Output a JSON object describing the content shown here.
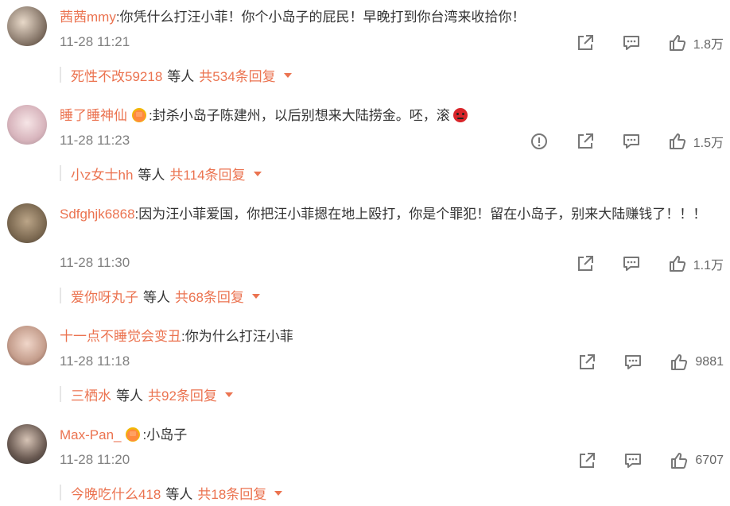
{
  "comments": [
    {
      "username": "茜茜mmy",
      "text": ":你凭什么打汪小菲！你个小岛子的屁民！早晚打到你台湾来收拾你！",
      "time": "11-28 11:21",
      "likes": "1.8万",
      "has_report": false,
      "reply": {
        "user": "死性不改59218",
        "etc": "等人",
        "total": "共534条回复"
      }
    },
    {
      "username": "睡了睡神仙",
      "badge": "crown-badge-icon",
      "text": ":封杀小岛子陈建州，以后别想来大陆捞金。呸，滚",
      "emoji": "angry-emoji-icon",
      "time": "11-28 11:23",
      "likes": "1.5万",
      "has_report": true,
      "reply": {
        "user": "小z女士hh",
        "etc": "等人",
        "total": "共114条回复"
      }
    },
    {
      "username": "Sdfghjk6868",
      "text": ":因为汪小菲爱国，你把汪小菲摁在地上殴打，你是个罪犯！留在小岛子，别来大陆赚钱了！！！",
      "time": "11-28 11:30",
      "likes": "1.1万",
      "has_report": false,
      "reply": {
        "user": "爱你呀丸子",
        "etc": "等人",
        "total": "共68条回复"
      }
    },
    {
      "username": "十一点不睡觉会变丑",
      "text": ":你为什么打汪小菲",
      "time": "11-28 11:18",
      "likes": "9881",
      "has_report": false,
      "reply": {
        "user": "三栖水",
        "etc": "等人",
        "total": "共92条回复"
      }
    },
    {
      "username": "Max-Pan_",
      "badge": "crown-badge-icon",
      "text": ":小岛子",
      "time": "11-28 11:20",
      "likes": "6707",
      "has_report": false,
      "reply": {
        "user": "今晚吃什么418",
        "etc": "等人",
        "total": "共18条回复"
      }
    }
  ],
  "colors": {
    "accent": "#eb7350",
    "text": "#333333",
    "meta": "#808080"
  }
}
